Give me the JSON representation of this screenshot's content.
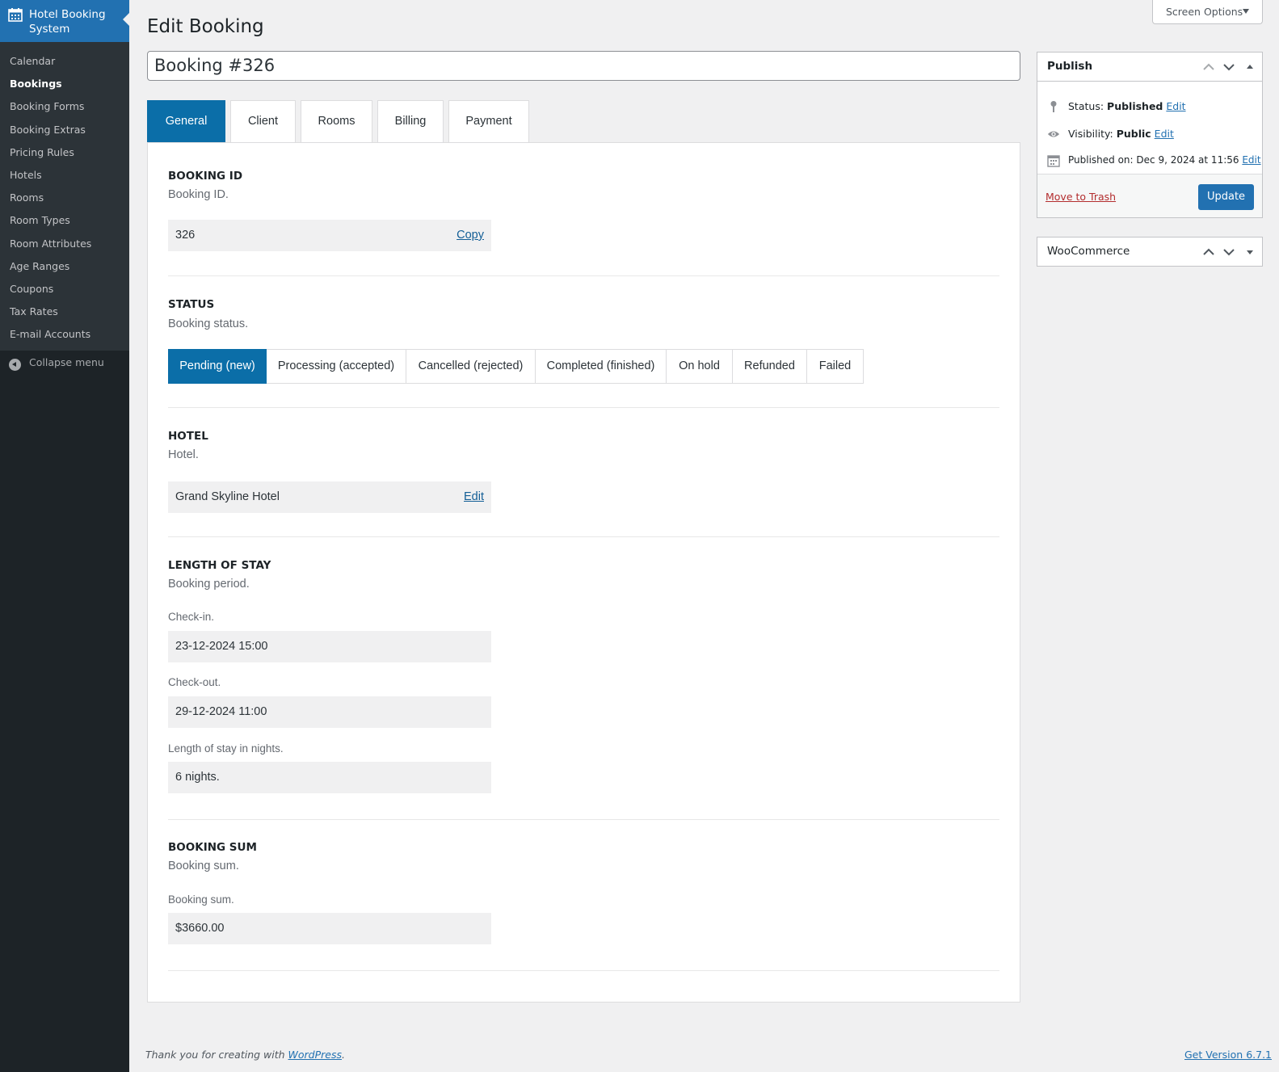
{
  "sidebar": {
    "title": "Hotel Booking System",
    "items": [
      {
        "label": "Calendar"
      },
      {
        "label": "Bookings"
      },
      {
        "label": "Booking Forms"
      },
      {
        "label": "Booking Extras"
      },
      {
        "label": "Pricing Rules"
      },
      {
        "label": "Hotels"
      },
      {
        "label": "Rooms"
      },
      {
        "label": "Room Types"
      },
      {
        "label": "Room Attributes"
      },
      {
        "label": "Age Ranges"
      },
      {
        "label": "Coupons"
      },
      {
        "label": "Tax Rates"
      },
      {
        "label": "E-mail Accounts"
      }
    ],
    "current": "Bookings",
    "collapse_label": "Collapse menu"
  },
  "screen_options": "Screen Options",
  "page_title": "Edit Booking",
  "post_title": "Booking #326",
  "tabs": [
    {
      "label": "General"
    },
    {
      "label": "Client"
    },
    {
      "label": "Rooms"
    },
    {
      "label": "Billing"
    },
    {
      "label": "Payment"
    }
  ],
  "active_tab": "General",
  "sections": {
    "booking_id": {
      "title": "BOOKING ID",
      "desc": "Booking ID.",
      "value": "326",
      "action": "Copy"
    },
    "status": {
      "title": "STATUS",
      "desc": "Booking status.",
      "options": [
        {
          "label": "Pending (new)"
        },
        {
          "label": "Processing (accepted)"
        },
        {
          "label": "Cancelled (rejected)"
        },
        {
          "label": "Completed (finished)"
        },
        {
          "label": "On hold"
        },
        {
          "label": "Refunded"
        },
        {
          "label": "Failed"
        }
      ],
      "selected": "Pending (new)"
    },
    "hotel": {
      "title": "HOTEL",
      "desc": "Hotel.",
      "value": "Grand Skyline Hotel",
      "action": "Edit"
    },
    "stay": {
      "title": "LENGTH OF STAY",
      "desc": "Booking period.",
      "checkin_label": "Check-in.",
      "checkin_value": "23-12-2024 15:00",
      "checkout_label": "Check-out.",
      "checkout_value": "29-12-2024 11:00",
      "nights_label": "Length of stay in nights.",
      "nights_value": "6 nights."
    },
    "sum": {
      "title": "BOOKING SUM",
      "desc": "Booking sum.",
      "label": "Booking sum.",
      "value": "$3660.00"
    }
  },
  "publish": {
    "title": "Publish",
    "status_key": "Status:",
    "status_value": "Published",
    "visibility_key": "Visibility:",
    "visibility_value": "Public",
    "published_key": "Published on:",
    "published_value": "Dec 9, 2024 at 11:56",
    "edit_label": "Edit",
    "trash_label": "Move to Trash",
    "update_label": "Update"
  },
  "woocommerce": {
    "title": "WooCommerce"
  },
  "footer": {
    "thanks_prefix": "Thank you for creating with",
    "thanks_link": "WordPress",
    "thanks_suffix": ".",
    "version_link": "Get Version 6.7.1"
  },
  "colors": {
    "accent": "#0b6ea8",
    "sidebar_bg": "#1d2327",
    "menu_head_bg": "#2271b1",
    "trash": "#b32d2e"
  }
}
